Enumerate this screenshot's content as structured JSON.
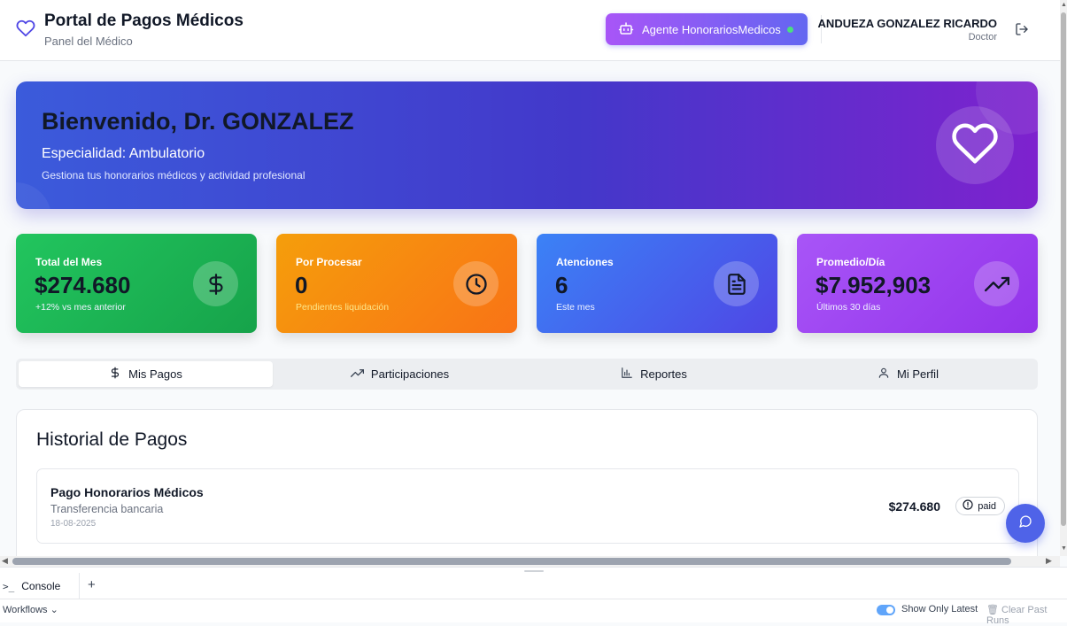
{
  "header": {
    "title": "Portal de Pagos Médicos",
    "subtitle": "Panel del Médico",
    "agent_button": "Agente HonorariosMedicos",
    "user_name": "ANDUEZA GONZALEZ RICARDO",
    "user_role": "Doctor"
  },
  "banner": {
    "title": "Bienvenido, Dr. GONZALEZ",
    "specialty": "Especialidad: Ambulatorio",
    "description": "Gestiona tus honorarios médicos y actividad profesional"
  },
  "stats": [
    {
      "label": "Total del Mes",
      "value": "$274.680",
      "sub": "+12% vs mes anterior",
      "icon": "dollar-icon"
    },
    {
      "label": "Por Procesar",
      "value": "0",
      "sub": "Pendientes liquidación",
      "icon": "clock-icon"
    },
    {
      "label": "Atenciones",
      "value": "6",
      "sub": "Este mes",
      "icon": "document-icon"
    },
    {
      "label": "Promedio/Día",
      "value": "$7.952,903",
      "sub": "Últimos 30 días",
      "icon": "trending-up-icon"
    }
  ],
  "tabs": [
    {
      "label": "Mis Pagos",
      "active": true
    },
    {
      "label": "Participaciones",
      "active": false
    },
    {
      "label": "Reportes",
      "active": false
    },
    {
      "label": "Mi Perfil",
      "active": false
    }
  ],
  "history": {
    "title": "Historial de Pagos",
    "payments": [
      {
        "title": "Pago Honorarios Médicos",
        "method": "Transferencia bancaria",
        "date": "18-08-2025",
        "amount": "$274.680",
        "status": "paid"
      }
    ]
  },
  "console": {
    "tab_label": "Console",
    "add_label": "+",
    "workflows_label": "Workflows",
    "show_latest_label": "Show Only Latest",
    "clear_label": "Clear Past Runs"
  },
  "colors": {
    "primary": "#4f46e5",
    "green": "#16a34a",
    "orange": "#f97316",
    "purple": "#9333ea"
  }
}
